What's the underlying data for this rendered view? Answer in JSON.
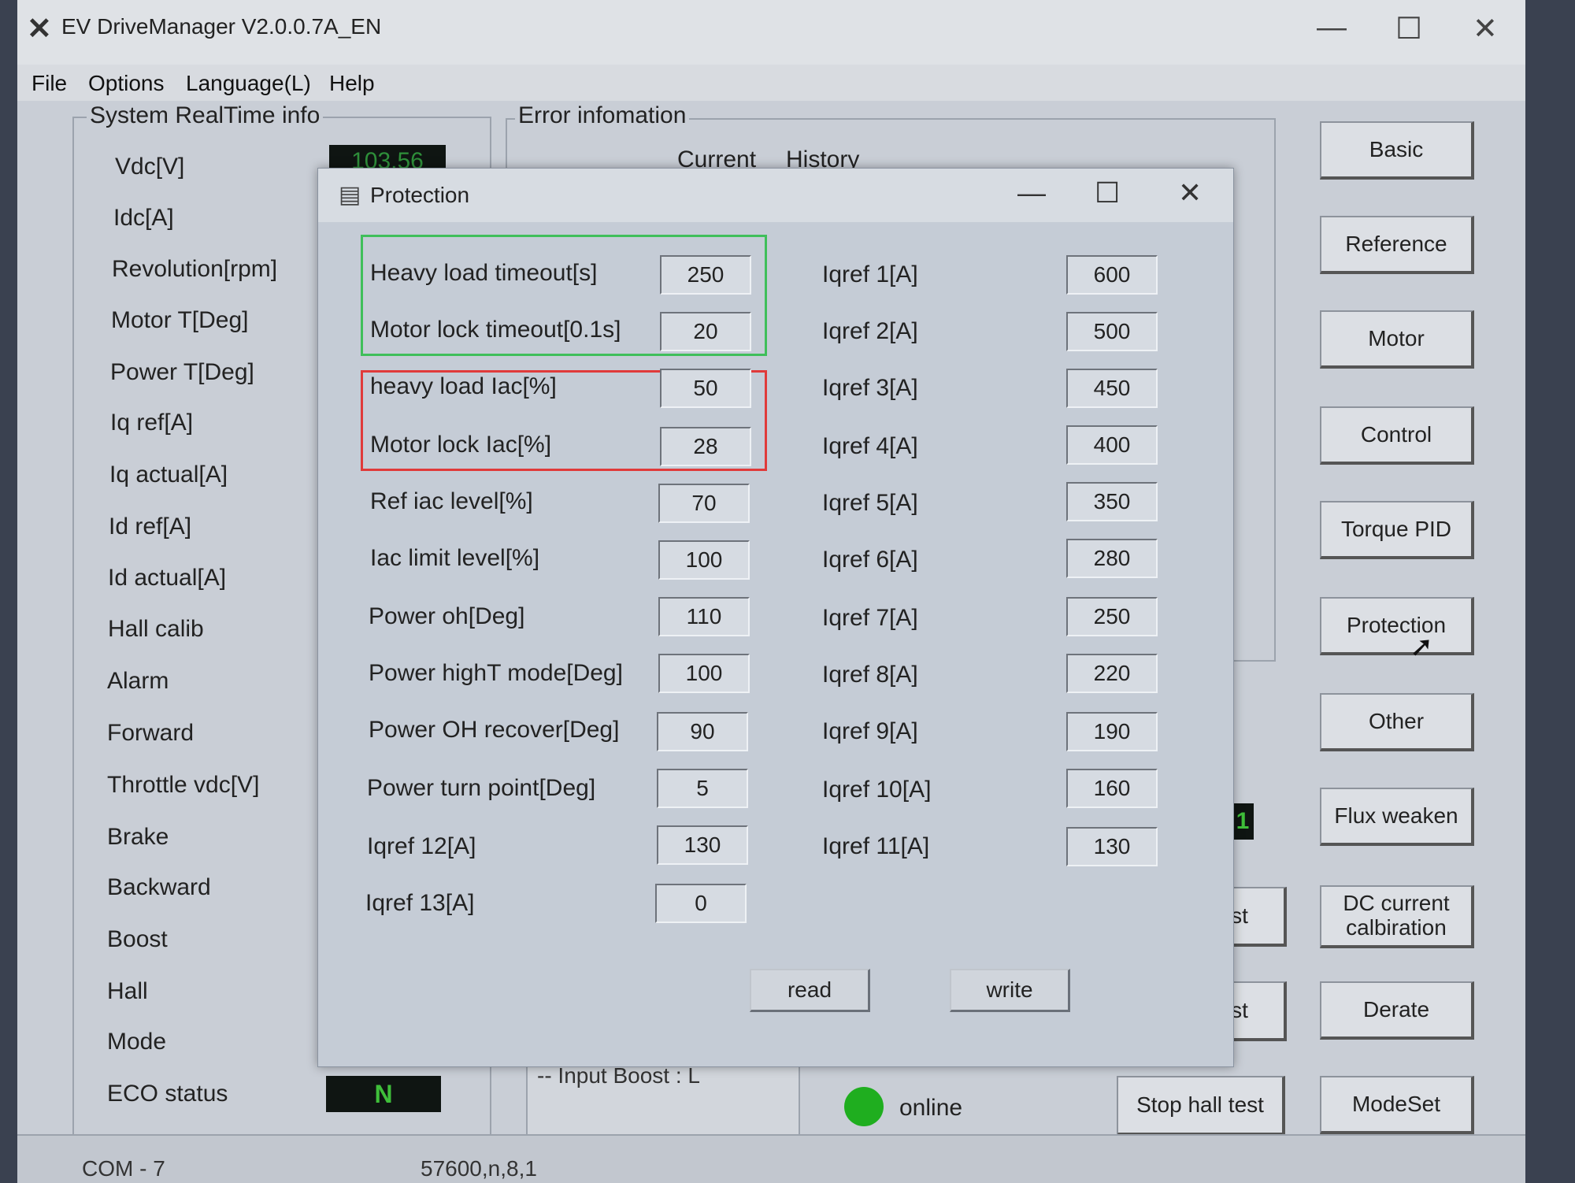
{
  "app": {
    "title": "EV DriveManager V2.0.0.7A_EN",
    "icon": "app-x-icon",
    "menu": [
      "File",
      "Options",
      "Language(L)",
      "Help"
    ]
  },
  "realtime": {
    "title": "System RealTime info",
    "vdc_value": "103.56",
    "labels": [
      "Vdc[V]",
      "Idc[A]",
      "Revolution[rpm]",
      "Motor T[Deg]",
      "Power T[Deg]",
      "Iq ref[A]",
      "Iq actual[A]",
      "Id ref[A]",
      "Id actual[A]",
      "Hall calib",
      "Alarm",
      "Forward",
      "Throttle vdc[V]",
      "Brake",
      "Backward",
      "Boost",
      "Hall",
      "Mode",
      "ECO status"
    ],
    "eco_value": "N"
  },
  "error": {
    "title": "Error infomation",
    "current_label": "Current",
    "history_label": "History",
    "log_text": "-- Input Boost : L"
  },
  "side_buttons": [
    "Basic",
    "Reference",
    "Motor",
    "Control",
    "Torque PID",
    "Protection",
    "Other",
    "Flux weaken",
    "DC current calbiration",
    "Derate",
    "ModeSet"
  ],
  "partial": {
    "indicator": "1",
    "btn1": "st",
    "btn2": "st",
    "stop_hall": "Stop hall test"
  },
  "online_label": "online",
  "status": {
    "port": "COM - 7",
    "baud": "57600,n,8,1"
  },
  "dialog": {
    "title": "Protection",
    "left": [
      {
        "label": "Heavy load timeout[s]",
        "value": "250"
      },
      {
        "label": "Motor lock timeout[0.1s]",
        "value": "20"
      },
      {
        "label": "heavy load Iac[%]",
        "value": "50"
      },
      {
        "label": "Motor lock Iac[%]",
        "value": "28"
      },
      {
        "label": "Ref iac level[%]",
        "value": "70"
      },
      {
        "label": "Iac limit level[%]",
        "value": "100"
      },
      {
        "label": "Power oh[Deg]",
        "value": "110"
      },
      {
        "label": "Power highT mode[Deg]",
        "value": "100"
      },
      {
        "label": "Power OH recover[Deg]",
        "value": "90"
      },
      {
        "label": "Power turn point[Deg]",
        "value": "5"
      },
      {
        "label": "Iqref 12[A]",
        "value": "130"
      },
      {
        "label": "Iqref 13[A]",
        "value": "0"
      }
    ],
    "right": [
      {
        "label": "Iqref 1[A]",
        "value": "600"
      },
      {
        "label": "Iqref 2[A]",
        "value": "500"
      },
      {
        "label": "Iqref 3[A]",
        "value": "450"
      },
      {
        "label": "Iqref 4[A]",
        "value": "400"
      },
      {
        "label": "Iqref 5[A]",
        "value": "350"
      },
      {
        "label": "Iqref 6[A]",
        "value": "280"
      },
      {
        "label": "Iqref 7[A]",
        "value": "250"
      },
      {
        "label": "Iqref 8[A]",
        "value": "220"
      },
      {
        "label": "Iqref 9[A]",
        "value": "190"
      },
      {
        "label": "Iqref 10[A]",
        "value": "160"
      },
      {
        "label": "Iqref 11[A]",
        "value": "130"
      }
    ],
    "read_label": "read",
    "write_label": "write",
    "highlight_colors": {
      "green": "#3fbf5a",
      "red": "#e03a3a"
    }
  }
}
